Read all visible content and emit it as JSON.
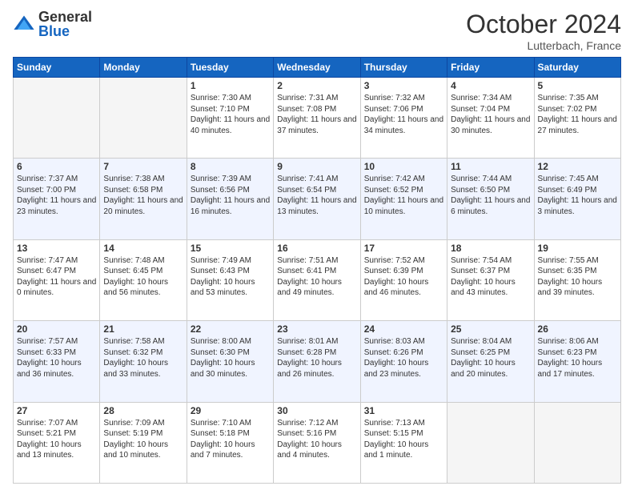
{
  "header": {
    "logo_general": "General",
    "logo_blue": "Blue",
    "month_title": "October 2024",
    "location": "Lutterbach, France"
  },
  "days_of_week": [
    "Sunday",
    "Monday",
    "Tuesday",
    "Wednesday",
    "Thursday",
    "Friday",
    "Saturday"
  ],
  "weeks": [
    [
      {
        "day": "",
        "sunrise": "",
        "sunset": "",
        "daylight": "",
        "empty": true
      },
      {
        "day": "",
        "sunrise": "",
        "sunset": "",
        "daylight": "",
        "empty": true
      },
      {
        "day": "1",
        "sunrise": "Sunrise: 7:30 AM",
        "sunset": "Sunset: 7:10 PM",
        "daylight": "Daylight: 11 hours and 40 minutes.",
        "empty": false
      },
      {
        "day": "2",
        "sunrise": "Sunrise: 7:31 AM",
        "sunset": "Sunset: 7:08 PM",
        "daylight": "Daylight: 11 hours and 37 minutes.",
        "empty": false
      },
      {
        "day": "3",
        "sunrise": "Sunrise: 7:32 AM",
        "sunset": "Sunset: 7:06 PM",
        "daylight": "Daylight: 11 hours and 34 minutes.",
        "empty": false
      },
      {
        "day": "4",
        "sunrise": "Sunrise: 7:34 AM",
        "sunset": "Sunset: 7:04 PM",
        "daylight": "Daylight: 11 hours and 30 minutes.",
        "empty": false
      },
      {
        "day": "5",
        "sunrise": "Sunrise: 7:35 AM",
        "sunset": "Sunset: 7:02 PM",
        "daylight": "Daylight: 11 hours and 27 minutes.",
        "empty": false
      }
    ],
    [
      {
        "day": "6",
        "sunrise": "Sunrise: 7:37 AM",
        "sunset": "Sunset: 7:00 PM",
        "daylight": "Daylight: 11 hours and 23 minutes.",
        "empty": false
      },
      {
        "day": "7",
        "sunrise": "Sunrise: 7:38 AM",
        "sunset": "Sunset: 6:58 PM",
        "daylight": "Daylight: 11 hours and 20 minutes.",
        "empty": false
      },
      {
        "day": "8",
        "sunrise": "Sunrise: 7:39 AM",
        "sunset": "Sunset: 6:56 PM",
        "daylight": "Daylight: 11 hours and 16 minutes.",
        "empty": false
      },
      {
        "day": "9",
        "sunrise": "Sunrise: 7:41 AM",
        "sunset": "Sunset: 6:54 PM",
        "daylight": "Daylight: 11 hours and 13 minutes.",
        "empty": false
      },
      {
        "day": "10",
        "sunrise": "Sunrise: 7:42 AM",
        "sunset": "Sunset: 6:52 PM",
        "daylight": "Daylight: 11 hours and 10 minutes.",
        "empty": false
      },
      {
        "day": "11",
        "sunrise": "Sunrise: 7:44 AM",
        "sunset": "Sunset: 6:50 PM",
        "daylight": "Daylight: 11 hours and 6 minutes.",
        "empty": false
      },
      {
        "day": "12",
        "sunrise": "Sunrise: 7:45 AM",
        "sunset": "Sunset: 6:49 PM",
        "daylight": "Daylight: 11 hours and 3 minutes.",
        "empty": false
      }
    ],
    [
      {
        "day": "13",
        "sunrise": "Sunrise: 7:47 AM",
        "sunset": "Sunset: 6:47 PM",
        "daylight": "Daylight: 11 hours and 0 minutes.",
        "empty": false
      },
      {
        "day": "14",
        "sunrise": "Sunrise: 7:48 AM",
        "sunset": "Sunset: 6:45 PM",
        "daylight": "Daylight: 10 hours and 56 minutes.",
        "empty": false
      },
      {
        "day": "15",
        "sunrise": "Sunrise: 7:49 AM",
        "sunset": "Sunset: 6:43 PM",
        "daylight": "Daylight: 10 hours and 53 minutes.",
        "empty": false
      },
      {
        "day": "16",
        "sunrise": "Sunrise: 7:51 AM",
        "sunset": "Sunset: 6:41 PM",
        "daylight": "Daylight: 10 hours and 49 minutes.",
        "empty": false
      },
      {
        "day": "17",
        "sunrise": "Sunrise: 7:52 AM",
        "sunset": "Sunset: 6:39 PM",
        "daylight": "Daylight: 10 hours and 46 minutes.",
        "empty": false
      },
      {
        "day": "18",
        "sunrise": "Sunrise: 7:54 AM",
        "sunset": "Sunset: 6:37 PM",
        "daylight": "Daylight: 10 hours and 43 minutes.",
        "empty": false
      },
      {
        "day": "19",
        "sunrise": "Sunrise: 7:55 AM",
        "sunset": "Sunset: 6:35 PM",
        "daylight": "Daylight: 10 hours and 39 minutes.",
        "empty": false
      }
    ],
    [
      {
        "day": "20",
        "sunrise": "Sunrise: 7:57 AM",
        "sunset": "Sunset: 6:33 PM",
        "daylight": "Daylight: 10 hours and 36 minutes.",
        "empty": false
      },
      {
        "day": "21",
        "sunrise": "Sunrise: 7:58 AM",
        "sunset": "Sunset: 6:32 PM",
        "daylight": "Daylight: 10 hours and 33 minutes.",
        "empty": false
      },
      {
        "day": "22",
        "sunrise": "Sunrise: 8:00 AM",
        "sunset": "Sunset: 6:30 PM",
        "daylight": "Daylight: 10 hours and 30 minutes.",
        "empty": false
      },
      {
        "day": "23",
        "sunrise": "Sunrise: 8:01 AM",
        "sunset": "Sunset: 6:28 PM",
        "daylight": "Daylight: 10 hours and 26 minutes.",
        "empty": false
      },
      {
        "day": "24",
        "sunrise": "Sunrise: 8:03 AM",
        "sunset": "Sunset: 6:26 PM",
        "daylight": "Daylight: 10 hours and 23 minutes.",
        "empty": false
      },
      {
        "day": "25",
        "sunrise": "Sunrise: 8:04 AM",
        "sunset": "Sunset: 6:25 PM",
        "daylight": "Daylight: 10 hours and 20 minutes.",
        "empty": false
      },
      {
        "day": "26",
        "sunrise": "Sunrise: 8:06 AM",
        "sunset": "Sunset: 6:23 PM",
        "daylight": "Daylight: 10 hours and 17 minutes.",
        "empty": false
      }
    ],
    [
      {
        "day": "27",
        "sunrise": "Sunrise: 7:07 AM",
        "sunset": "Sunset: 5:21 PM",
        "daylight": "Daylight: 10 hours and 13 minutes.",
        "empty": false
      },
      {
        "day": "28",
        "sunrise": "Sunrise: 7:09 AM",
        "sunset": "Sunset: 5:19 PM",
        "daylight": "Daylight: 10 hours and 10 minutes.",
        "empty": false
      },
      {
        "day": "29",
        "sunrise": "Sunrise: 7:10 AM",
        "sunset": "Sunset: 5:18 PM",
        "daylight": "Daylight: 10 hours and 7 minutes.",
        "empty": false
      },
      {
        "day": "30",
        "sunrise": "Sunrise: 7:12 AM",
        "sunset": "Sunset: 5:16 PM",
        "daylight": "Daylight: 10 hours and 4 minutes.",
        "empty": false
      },
      {
        "day": "31",
        "sunrise": "Sunrise: 7:13 AM",
        "sunset": "Sunset: 5:15 PM",
        "daylight": "Daylight: 10 hours and 1 minute.",
        "empty": false
      },
      {
        "day": "",
        "sunrise": "",
        "sunset": "",
        "daylight": "",
        "empty": true
      },
      {
        "day": "",
        "sunrise": "",
        "sunset": "",
        "daylight": "",
        "empty": true
      }
    ]
  ]
}
